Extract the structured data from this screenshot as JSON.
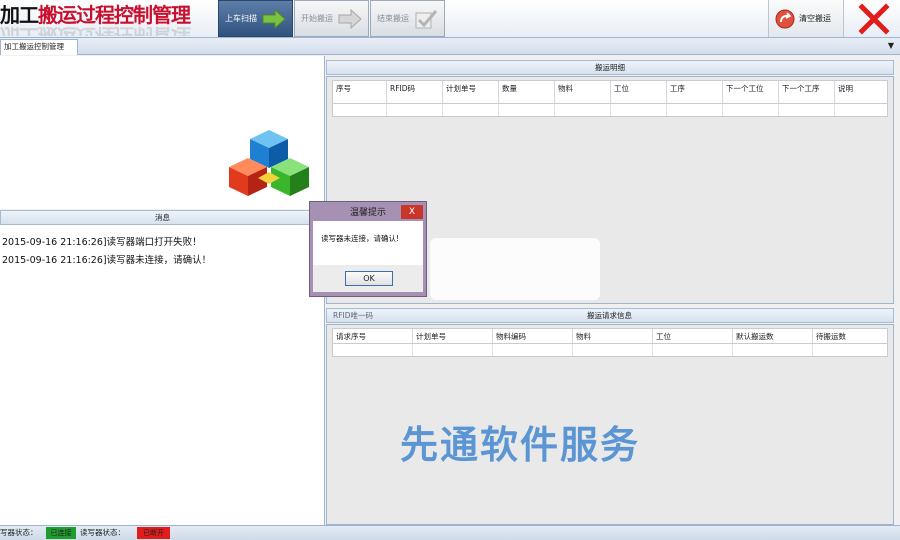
{
  "header": {
    "title_part1": "加工",
    "title_part2": "搬运过程控制管理",
    "reflection": "加工搬运过程控制管理",
    "steps": [
      {
        "label": "上车扫描",
        "active": true
      },
      {
        "label": "开始搬运",
        "active": false
      },
      {
        "label": "结束搬运",
        "active": false
      }
    ],
    "clear_label": "清空搬运"
  },
  "tabs": {
    "active": "加工搬运控制管理"
  },
  "messages": {
    "header": "消息",
    "lines": [
      "2015-09-16 21:16:26]读写器端口打开失败！",
      "2015-09-16 21:16:26]读写器未连接，请确认！"
    ]
  },
  "transport_detail": {
    "header": "搬运明细",
    "columns": [
      "序号",
      "RFID码",
      "计划单号",
      "数量",
      "物料",
      "工位",
      "工序",
      "下一个工位",
      "下一个工序",
      "说明"
    ]
  },
  "request_info": {
    "rfid_label": "RFID唯一码",
    "header": "搬运请求信息",
    "columns": [
      "请求序号",
      "计划单号",
      "物料编码",
      "物料",
      "工位",
      "默认搬运数",
      "待搬运数"
    ]
  },
  "dialog": {
    "title": "温馨提示",
    "close": "X",
    "message": "读写器未连接，请确认!",
    "ok": "OK"
  },
  "watermark": "先通软件服务",
  "status": {
    "writer_label": "写器状态：",
    "writer_value": "已连接",
    "reader_label": "读写器状态：",
    "reader_value": "已断开"
  },
  "colors": {
    "accent": "#2f527f",
    "connected": "#1f9c2e",
    "disconnected": "#e21b1b",
    "watermark": "#5b95d3"
  }
}
